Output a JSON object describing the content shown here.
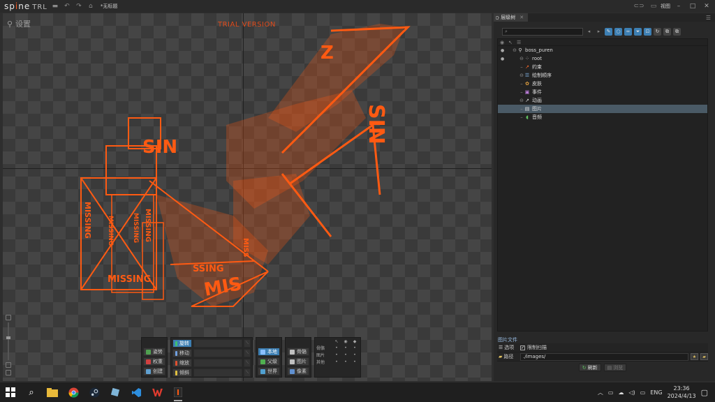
{
  "app": {
    "logo_text_1": "sp",
    "logo_text_2": "ne",
    "logo_trl": "TRL",
    "doc_title": "*无标题",
    "view_label": "视图"
  },
  "viewport": {
    "mode_label": "设置",
    "trial_text": "TRIAL VERSION",
    "missing_texts": [
      "MISSING",
      "MISSING",
      "MISSING",
      "MISSING",
      "MISSING",
      "SIN",
      "MIS",
      "Z",
      "SSING",
      "SIN",
      "MISS"
    ]
  },
  "toolbar": {
    "left_group": [
      "姿势",
      "权重",
      "创建"
    ],
    "transform_group": [
      "旋转",
      "移动",
      "缩放",
      "倾斜"
    ],
    "axes_group": [
      "本地",
      "父级",
      "世界"
    ],
    "compensate_group": [
      "骨骼",
      "图片",
      "像素"
    ],
    "options_rows": [
      "骨骼",
      "图片",
      "其他"
    ]
  },
  "panel": {
    "tab_label": "层级树",
    "search_placeholder": "",
    "tree": [
      {
        "label": "boss_puren",
        "depth": 0,
        "icon": "skeleton-icon",
        "icon_color": "#dddddd",
        "vis": "●"
      },
      {
        "label": "root",
        "depth": 1,
        "icon": "bone-icon",
        "icon_color": "#cccccc",
        "vis": "●"
      },
      {
        "label": "约束",
        "depth": 1,
        "icon": "constraint-icon",
        "icon_color": "#ff6a2a",
        "vis": ""
      },
      {
        "label": "绘制顺序",
        "depth": 1,
        "icon": "draw-order-icon",
        "icon_color": "#7fb0e0",
        "vis": ""
      },
      {
        "label": "皮肤",
        "depth": 1,
        "icon": "skin-icon",
        "icon_color": "#e0a040",
        "vis": ""
      },
      {
        "label": "事件",
        "depth": 1,
        "icon": "event-icon",
        "icon_color": "#c080e0",
        "vis": ""
      },
      {
        "label": "动画",
        "depth": 1,
        "icon": "animation-icon",
        "icon_color": "#dddddd",
        "vis": ""
      },
      {
        "label": "图片",
        "depth": 1,
        "icon": "images-icon",
        "icon_color": "#e0e0e0",
        "vis": ""
      },
      {
        "label": "音频",
        "depth": 1,
        "icon": "audio-icon",
        "icon_color": "#60c060",
        "vis": ""
      }
    ],
    "images": {
      "title": "图片文件",
      "options_label": "选项",
      "checkbox_label": "限制扫描",
      "path_label": "路径",
      "path_value": "./images/",
      "refresh_label": "刷新",
      "browse_label": "浏览"
    }
  },
  "taskbar": {
    "lang": "ENG",
    "time": "23:36",
    "date": "2024/4/13"
  },
  "colors": {
    "accent": "#3d7fb3",
    "orange": "#ff5a12"
  }
}
